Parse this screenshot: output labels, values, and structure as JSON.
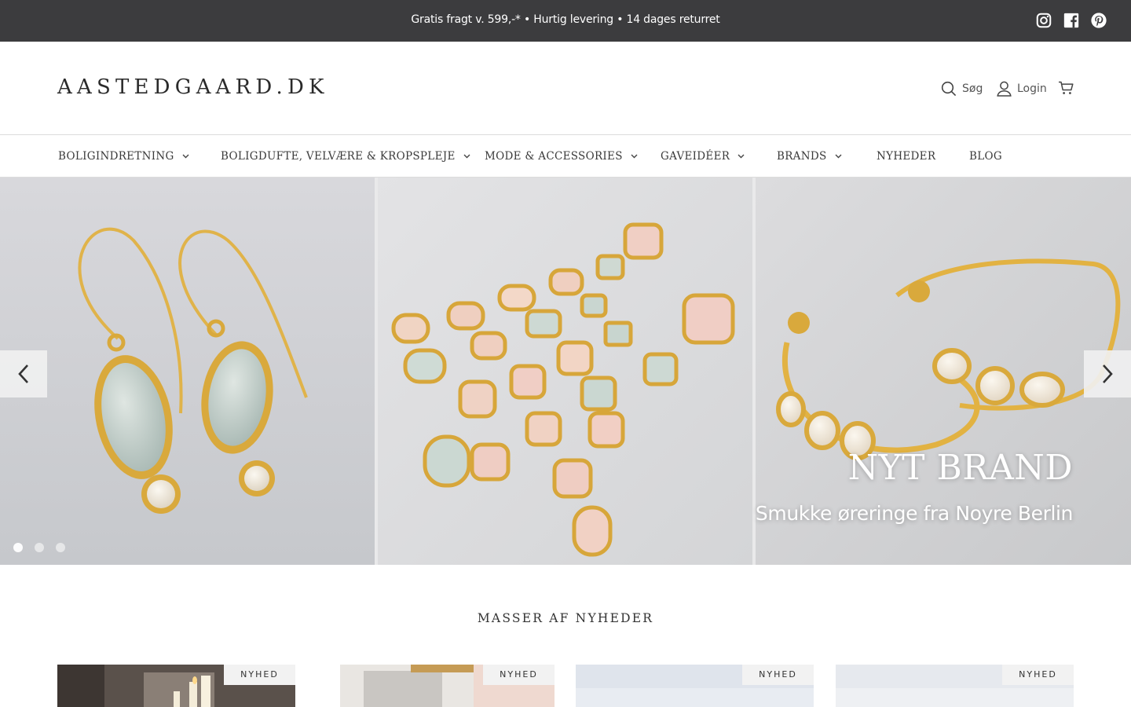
{
  "announcement": {
    "text": "Gratis fragt v. 599,-* • Hurtig levering • 14 dages returret"
  },
  "social": [
    "instagram-icon",
    "facebook-icon",
    "pinterest-icon"
  ],
  "header": {
    "logo": "AASTEDGAARD.DK",
    "search_label": "Søg",
    "login_label": "Login"
  },
  "nav": {
    "items": [
      {
        "label": "BOLIGINDRETNING",
        "dropdown": true
      },
      {
        "label": "BOLIGDUFTE, VELVÆRE & KROPSPLEJE",
        "dropdown": true
      },
      {
        "label": "MODE & ACCESSORIES",
        "dropdown": true
      },
      {
        "label": "GAVEIDÉER",
        "dropdown": true
      },
      {
        "label": "BRANDS",
        "dropdown": true
      },
      {
        "label": "NYHEDER",
        "dropdown": false
      },
      {
        "label": "BLOG",
        "dropdown": false
      }
    ]
  },
  "hero": {
    "title": "NYT BRAND",
    "subtitle": "Smukke øreringe fra Noyre Berlin",
    "slide_count": 3,
    "active_slide": 1
  },
  "section": {
    "title": "MASSER AF NYHEDER"
  },
  "products": [
    {
      "badge": "NYHED"
    },
    {
      "badge": "NYHED"
    },
    {
      "badge": "NYHED"
    },
    {
      "badge": "NYHED"
    }
  ],
  "colors": {
    "topbar": "#3c3c3e",
    "gold": "#e2b444",
    "hero_bg": "#e9e9ea"
  }
}
